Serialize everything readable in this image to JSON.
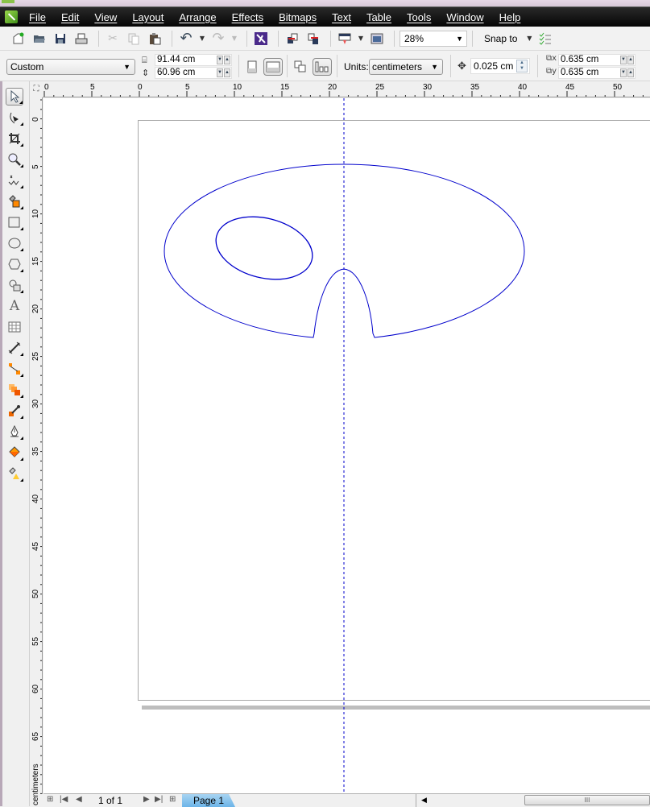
{
  "app": {
    "name": "CorelDRAW"
  },
  "menu": [
    "File",
    "Edit",
    "View",
    "Layout",
    "Arrange",
    "Effects",
    "Bitmaps",
    "Text",
    "Table",
    "Tools",
    "Window",
    "Help"
  ],
  "toolbar": {
    "buttons": [
      {
        "name": "new-document",
        "icon": "new-document-icon",
        "enabled": true
      },
      {
        "name": "open",
        "icon": "folder-open-icon",
        "enabled": true
      },
      {
        "name": "save",
        "icon": "save-icon",
        "enabled": true
      },
      {
        "name": "print",
        "icon": "print-icon",
        "enabled": true
      },
      {
        "name": "cut",
        "icon": "scissors-icon",
        "enabled": false
      },
      {
        "name": "copy",
        "icon": "copy-icon",
        "enabled": false
      },
      {
        "name": "paste",
        "icon": "paste-icon",
        "enabled": true
      },
      {
        "name": "undo",
        "icon": "undo-icon",
        "enabled": true
      },
      {
        "name": "redo",
        "icon": "redo-icon",
        "enabled": false
      },
      {
        "name": "search-content",
        "icon": "corel-connect-icon",
        "enabled": true
      },
      {
        "name": "import",
        "icon": "import-icon",
        "enabled": true
      },
      {
        "name": "export",
        "icon": "export-icon",
        "enabled": true
      },
      {
        "name": "application-launcher",
        "icon": "app-launcher-icon",
        "enabled": true
      },
      {
        "name": "welcome-screen",
        "icon": "welcome-screen-icon",
        "enabled": true
      }
    ],
    "zoom_level": "28%",
    "snap_to_label": "Snap to"
  },
  "property_bar": {
    "page_preset": "Custom",
    "page_width": "91.44 cm",
    "page_height": "60.96 cm",
    "units_label": "Units:",
    "units_value": "centimeters",
    "nudge_distance": "0.025 cm",
    "duplicate_x": "0.635 cm",
    "duplicate_y": "0.635 cm"
  },
  "toolbox": [
    {
      "name": "pick-tool",
      "icon": "pointer-icon",
      "active": true
    },
    {
      "name": "shape-tool",
      "icon": "shape-node-icon"
    },
    {
      "name": "crop-tool",
      "icon": "crop-icon"
    },
    {
      "name": "zoom-tool",
      "icon": "magnifier-icon"
    },
    {
      "name": "freehand-tool",
      "icon": "freehand-icon"
    },
    {
      "name": "smart-fill-tool",
      "icon": "smart-fill-icon"
    },
    {
      "name": "rectangle-tool",
      "icon": "rectangle-icon"
    },
    {
      "name": "ellipse-tool",
      "icon": "ellipse-icon"
    },
    {
      "name": "polygon-tool",
      "icon": "polygon-icon"
    },
    {
      "name": "basic-shapes-tool",
      "icon": "basic-shapes-icon"
    },
    {
      "name": "text-tool",
      "icon": "text-a-icon"
    },
    {
      "name": "table-tool",
      "icon": "table-icon"
    },
    {
      "name": "dimension-tool",
      "icon": "dimension-icon"
    },
    {
      "name": "connector-tool",
      "icon": "connector-icon"
    },
    {
      "name": "blend-tool",
      "icon": "blend-icon"
    },
    {
      "name": "eyedropper-tool",
      "icon": "eyedropper-icon"
    },
    {
      "name": "outline-tool",
      "icon": "pen-nib-icon"
    },
    {
      "name": "fill-tool",
      "icon": "paint-bucket-icon"
    },
    {
      "name": "interactive-fill-tool",
      "icon": "interactive-fill-icon"
    }
  ],
  "rulers": {
    "horizontal_labels": [
      "0",
      "5",
      "0",
      "5",
      "10",
      "15",
      "20",
      "25",
      "30",
      "35",
      "40",
      "45",
      "50"
    ],
    "vertical_labels": [
      "0",
      "5",
      "10",
      "15",
      "20",
      "25",
      "30",
      "35",
      "40",
      "45",
      "50",
      "55",
      "60",
      "65"
    ],
    "units_caption": "centimeters"
  },
  "drawing": {
    "stroke_color": "#0000cc",
    "guide_color": "#0000cc"
  },
  "status": {
    "page_count": "1 of 1",
    "page_tab": "Page 1"
  }
}
